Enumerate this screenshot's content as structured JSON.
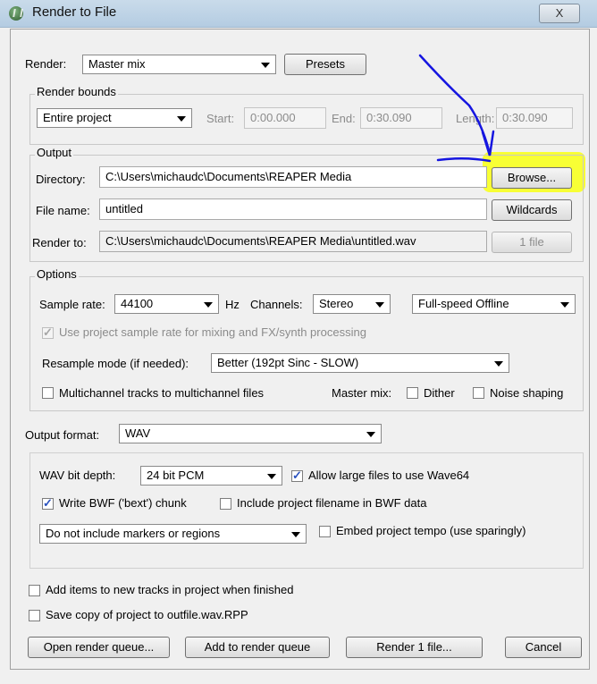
{
  "window": {
    "title": "Render to File",
    "close_glyph": "X"
  },
  "render": {
    "label": "Render:",
    "source": "Master mix",
    "presets_label": "Presets"
  },
  "bounds": {
    "group_label": "Render bounds",
    "mode": "Entire project",
    "start_label": "Start:",
    "start_value": "0:00.000",
    "end_label": "End:",
    "end_value": "0:30.090",
    "length_label": "Length:",
    "length_value": "0:30.090"
  },
  "output": {
    "group_label": "Output",
    "directory_label": "Directory:",
    "directory_value": "C:\\Users\\michaudc\\Documents\\REAPER Media",
    "browse_label": "Browse...",
    "filename_label": "File name:",
    "filename_value": "untitled",
    "wildcards_label": "Wildcards",
    "renderto_label": "Render to:",
    "renderto_value": "C:\\Users\\michaudc\\Documents\\REAPER Media\\untitled.wav",
    "files_label": "1 file"
  },
  "options": {
    "group_label": "Options",
    "samplerate_label": "Sample rate:",
    "samplerate_value": "44100",
    "hz_label": "Hz",
    "channels_label": "Channels:",
    "channels_value": "Stereo",
    "speed_value": "Full-speed Offline",
    "use_project_rate_label": "Use project sample rate for mixing and FX/synth processing",
    "resample_label": "Resample mode (if needed):",
    "resample_value": "Better (192pt Sinc - SLOW)",
    "multichannel_label": "Multichannel tracks to multichannel files",
    "mastermix_label": "Master mix:",
    "dither_label": "Dither",
    "noise_label": "Noise shaping"
  },
  "format": {
    "label": "Output format:",
    "value": "WAV",
    "bitdepth_label": "WAV bit depth:",
    "bitdepth_value": "24 bit PCM",
    "large_files_label": "Allow large files to use Wave64",
    "bwf_label": "Write BWF ('bext') chunk",
    "include_filename_label": "Include project filename in BWF data",
    "markers_value": "Do not include markers or regions",
    "tempo_label": "Embed project tempo (use sparingly)"
  },
  "footer": {
    "add_items_label": "Add items to new tracks in project when finished",
    "save_copy_label": "Save copy of project to outfile.wav.RPP",
    "open_queue_label": "Open render queue...",
    "add_queue_label": "Add to render queue",
    "render_label": "Render 1 file...",
    "cancel_label": "Cancel"
  },
  "colors": {
    "highlight": "#f8ff2a",
    "annotation_pen": "#1515e0"
  },
  "icons": {
    "app": "reaper-logo-icon",
    "close": "close-icon",
    "dropdown": "chevron-down-icon"
  }
}
